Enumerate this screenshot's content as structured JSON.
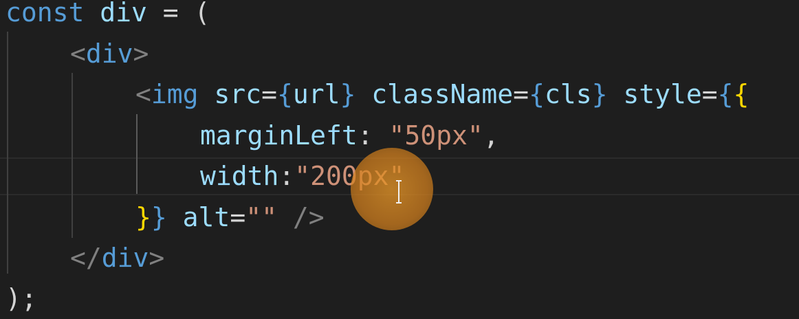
{
  "editor": {
    "lines": [
      {
        "tokens": [
          {
            "text": "const",
            "kind": "k"
          },
          {
            "text": " ",
            "kind": "p"
          },
          {
            "text": "div",
            "kind": "v"
          },
          {
            "text": " = (",
            "kind": "p"
          }
        ]
      },
      {
        "tokens": [
          {
            "text": "<",
            "kind": "t"
          },
          {
            "text": "div",
            "kind": "tn"
          },
          {
            "text": ">",
            "kind": "t"
          }
        ]
      },
      {
        "tokens": [
          {
            "text": "<",
            "kind": "t"
          },
          {
            "text": "img",
            "kind": "tn"
          },
          {
            "text": " ",
            "kind": "p"
          },
          {
            "text": "src",
            "kind": "a"
          },
          {
            "text": "=",
            "kind": "p"
          },
          {
            "text": "{",
            "kind": "br"
          },
          {
            "text": "url",
            "kind": "v"
          },
          {
            "text": "}",
            "kind": "br"
          },
          {
            "text": " ",
            "kind": "p"
          },
          {
            "text": "className",
            "kind": "a"
          },
          {
            "text": "=",
            "kind": "p"
          },
          {
            "text": "{",
            "kind": "br"
          },
          {
            "text": "cls",
            "kind": "v"
          },
          {
            "text": "}",
            "kind": "br"
          },
          {
            "text": " ",
            "kind": "p"
          },
          {
            "text": "style",
            "kind": "a"
          },
          {
            "text": "=",
            "kind": "p"
          },
          {
            "text": "{",
            "kind": "br"
          },
          {
            "text": "{",
            "kind": "br2"
          }
        ]
      },
      {
        "tokens": [
          {
            "text": "marginLeft",
            "kind": "v"
          },
          {
            "text": ": ",
            "kind": "p"
          },
          {
            "text": "\"50px\"",
            "kind": "s"
          },
          {
            "text": ",",
            "kind": "p"
          }
        ]
      },
      {
        "tokens": [
          {
            "text": "width",
            "kind": "v"
          },
          {
            "text": ":",
            "kind": "p"
          },
          {
            "text": "\"200px\"",
            "kind": "s"
          }
        ]
      },
      {
        "tokens": [
          {
            "text": "}",
            "kind": "br2"
          },
          {
            "text": "}",
            "kind": "br"
          },
          {
            "text": " ",
            "kind": "p"
          },
          {
            "text": "alt",
            "kind": "a"
          },
          {
            "text": "=",
            "kind": "p"
          },
          {
            "text": "\"\"",
            "kind": "s"
          },
          {
            "text": " ",
            "kind": "p"
          },
          {
            "text": "/>",
            "kind": "t"
          }
        ]
      },
      {
        "tokens": [
          {
            "text": "</",
            "kind": "t"
          },
          {
            "text": "div",
            "kind": "tn"
          },
          {
            "text": ">",
            "kind": "t"
          }
        ]
      },
      {
        "tokens": [
          {
            "text": ");",
            "kind": "p"
          }
        ]
      }
    ],
    "colors": {
      "background": "#1e1e1e",
      "keyword": "#569cd6",
      "variable": "#9cdcfe",
      "string": "#ce9178",
      "tag_bracket": "#808080",
      "nested_brace": "#ffd700",
      "cursor_highlight": "#e0962a"
    },
    "cursor": {
      "icon": "text-cursor-icon"
    }
  }
}
